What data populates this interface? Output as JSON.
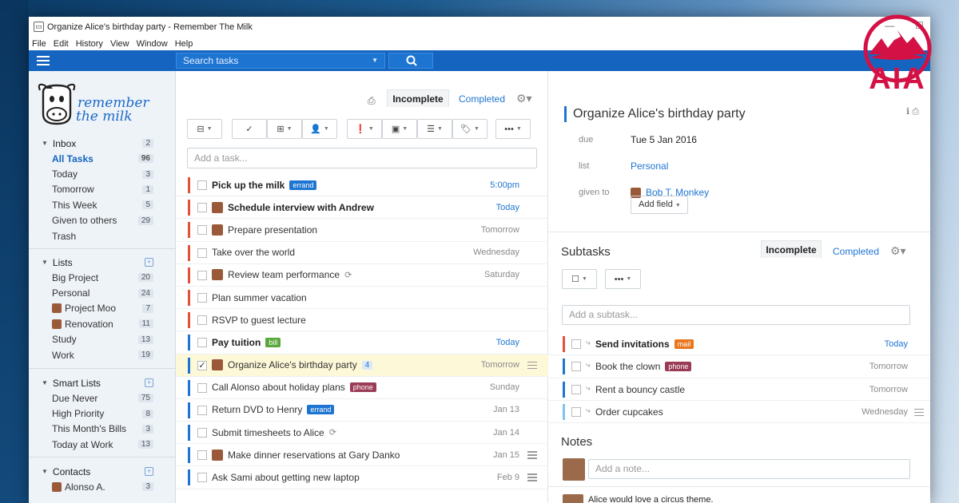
{
  "window": {
    "title": "Organize Alice's birthday party - Remember The Milk",
    "menu": [
      "File",
      "Edit",
      "History",
      "View",
      "Window",
      "Help"
    ]
  },
  "toolbar": {
    "search_placeholder": "Search tasks"
  },
  "logo": {
    "line1": "remember",
    "line2": "the milk"
  },
  "brand": {
    "watermark_text": "AIA",
    "color": "#d31145"
  },
  "sidebar": {
    "inbox": {
      "label": "Inbox",
      "count": "2",
      "items": [
        {
          "label": "All Tasks",
          "count": "96",
          "active": true
        },
        {
          "label": "Today",
          "count": "3"
        },
        {
          "label": "Tomorrow",
          "count": "1"
        },
        {
          "label": "This Week",
          "count": "5"
        },
        {
          "label": "Given to others",
          "count": "29"
        },
        {
          "label": "Trash",
          "count": ""
        }
      ]
    },
    "lists": {
      "label": "Lists",
      "items": [
        {
          "label": "Big Project",
          "count": "20"
        },
        {
          "label": "Personal",
          "count": "24"
        },
        {
          "label": "Project Moo",
          "count": "7",
          "avatar": true
        },
        {
          "label": "Renovation",
          "count": "11",
          "avatar": true
        },
        {
          "label": "Study",
          "count": "13"
        },
        {
          "label": "Work",
          "count": "19"
        }
      ]
    },
    "smart_lists": {
      "label": "Smart Lists",
      "items": [
        {
          "label": "Due Never",
          "count": "75"
        },
        {
          "label": "High Priority",
          "count": "8"
        },
        {
          "label": "This Month's Bills",
          "count": "3"
        },
        {
          "label": "Today at Work",
          "count": "13"
        }
      ]
    },
    "contacts": {
      "label": "Contacts",
      "items": [
        {
          "label": "Alonso A.",
          "count": "3",
          "avatar": true
        }
      ]
    }
  },
  "tasklist": {
    "tab_incomplete": "Incomplete",
    "tab_completed": "Completed",
    "add_placeholder": "Add a task...",
    "tasks": [
      {
        "name": "Pick up the milk",
        "bold": true,
        "tag": "errand",
        "tag_color": "#1e75d1",
        "due": "5:00pm",
        "due_blue": true,
        "prio": "#e0533a"
      },
      {
        "name": "Schedule interview with Andrew",
        "bold": true,
        "avatar": true,
        "due": "Today",
        "due_blue": true,
        "prio": "#e0533a"
      },
      {
        "name": "Prepare presentation",
        "avatar": true,
        "due": "Tomorrow",
        "prio": "#e0533a"
      },
      {
        "name": "Take over the world",
        "due": "Wednesday",
        "prio": "#e0533a"
      },
      {
        "name": "Review team performance",
        "avatar": true,
        "repeat": true,
        "due": "Saturday",
        "prio": "#e0533a"
      },
      {
        "name": "Plan summer vacation",
        "due": "",
        "prio": "#e0533a"
      },
      {
        "name": "RSVP to guest lecture",
        "due": "",
        "prio": "#e0533a"
      },
      {
        "name": "Pay tuition",
        "bold": true,
        "tag": "bill",
        "tag_color": "#5aa83c",
        "due": "Today",
        "due_blue": true,
        "prio": "#1e75d1"
      },
      {
        "name": "Organize Alice's birthday party",
        "avatar": true,
        "count": "4",
        "due": "Tomorrow",
        "note": true,
        "selected": true,
        "prio": "#1e75d1"
      },
      {
        "name": "Call Alonso about holiday plans",
        "tag": "phone",
        "tag_color": "#9b3c57",
        "due": "Sunday",
        "prio": "#1e75d1"
      },
      {
        "name": "Return DVD to Henry",
        "tag": "errand",
        "tag_color": "#1e75d1",
        "due": "Jan 13",
        "prio": "#1e75d1"
      },
      {
        "name": "Submit timesheets to Alice",
        "repeat": true,
        "due": "Jan 14",
        "prio": "#1e75d1"
      },
      {
        "name": "Make dinner reservations at Gary Danko",
        "avatar": true,
        "due": "Jan 15",
        "note": true,
        "prio": "#1e75d1"
      },
      {
        "name": "Ask Sami about getting new laptop",
        "due": "Feb 9",
        "note": true,
        "prio": "#1e75d1"
      }
    ]
  },
  "details": {
    "title": "Organize Alice's birthday party",
    "due_label": "due",
    "due_value": "Tue 5 Jan 2016",
    "list_label": "list",
    "list_value": "Personal",
    "given_label": "given to",
    "given_value": "Bob T. Monkey",
    "add_field": "Add field",
    "subtasks_title": "Subtasks",
    "sub_tab_incomplete": "Incomplete",
    "sub_tab_completed": "Completed",
    "add_subtask_placeholder": "Add a subtask...",
    "subtasks": [
      {
        "name": "Send invitations",
        "bold": true,
        "tag": "mail",
        "tag_color": "#e8761e",
        "due": "Today",
        "due_blue": true,
        "prio": "#e0533a"
      },
      {
        "name": "Book the clown",
        "tag": "phone",
        "tag_color": "#9b3c57",
        "due": "Tomorrow",
        "prio": "#1e75d1"
      },
      {
        "name": "Rent a bouncy castle",
        "due": "Tomorrow",
        "prio": "#1e75d1"
      },
      {
        "name": "Order cupcakes",
        "due": "Wednesday",
        "note": true,
        "prio": "#7ec3f0"
      }
    ],
    "notes_title": "Notes",
    "add_note_placeholder": "Add a note...",
    "note_1": "Alice would love a circus theme."
  }
}
